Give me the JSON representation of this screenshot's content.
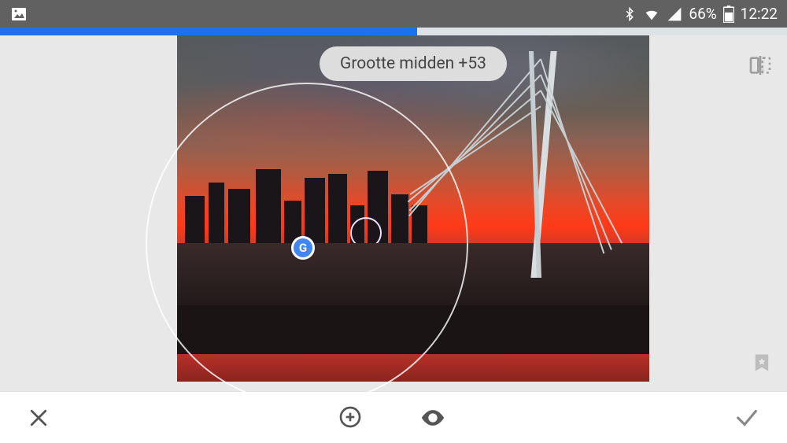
{
  "statusbar": {
    "battery_pct": "66%",
    "time": "12:22",
    "icons": {
      "pictures": "pictures-icon",
      "bluetooth": "bluetooth-icon",
      "wifi": "wifi-icon",
      "signal": "cell-signal-icon",
      "battery": "battery-icon"
    }
  },
  "progress": {
    "value": 53,
    "max": 100
  },
  "hud": {
    "tooltip": "Grootte midden +53",
    "marker_label": "G"
  },
  "canvas": {
    "compare_icon": "compare-icon",
    "bookmark_icon": "bookmark-icon"
  },
  "toolbar": {
    "cancel": "cancel-button",
    "add": "add-button",
    "preview": "preview-button",
    "confirm": "confirm-button"
  }
}
